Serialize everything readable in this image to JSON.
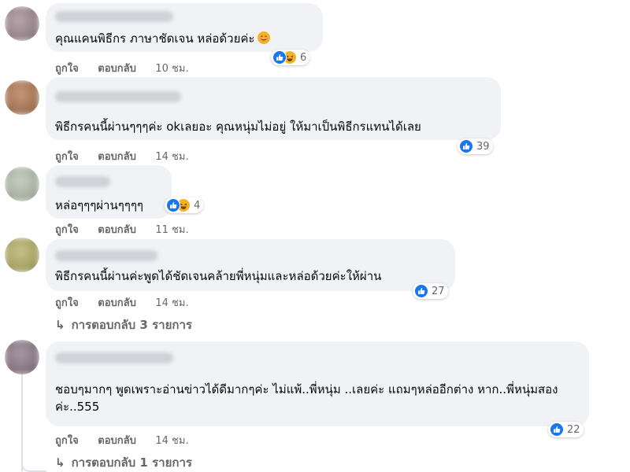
{
  "comments": [
    {
      "text": "คุณแคนพิธีกร ภาษาชัดเจน หล่อด้วยค่ะ",
      "emoji": "smiling-face",
      "reaction_count": "6",
      "like_label": "ถูกใจ",
      "reply_label": "ตอบกลับ",
      "time": "10 ชม."
    },
    {
      "text": "พิธีกรคนนี้ผ่านๆๆๆค่ะ okเลยอะ คุณหนุ่มไม่อยู่ ให้มาเป็นพิธีกรแทนได้เลย",
      "reaction_count": "39",
      "like_label": "ถูกใจ",
      "reply_label": "ตอบกลับ",
      "time": "14 ชม."
    },
    {
      "text": "หล่อๆๆๆผ่านๆๆๆๆ",
      "reaction_count": "4",
      "like_label": "ถูกใจ",
      "reply_label": "ตอบกลับ",
      "time": "11 ชม."
    },
    {
      "text": "พิธีกรคนนี้ผ่านค่ะพูดได้ชัดเจนคล้ายพี่หนุ่มและหล่อด้วยค่ะให้ผ่าน",
      "reaction_count": "27",
      "like_label": "ถูกใจ",
      "reply_label": "ตอบกลับ",
      "time": "14 ชม.",
      "replies_label": "การตอบกลับ 3 รายการ"
    },
    {
      "text": "ชอบๆมากๆ พูดเพราะอ่านข่าวได้ดีมากๆค่ะ ไม่แพ้..พี่หนุ่ม ..เลยค่ะ แถมๆหล่ออีกต่าง หาก..พี่หนุ่มสองค่ะ..555",
      "reaction_count": "22",
      "like_label": "ถูกใจ",
      "reply_label": "ตอบกลับ",
      "time": "14 ชม.",
      "replies_label": "การตอบกลับ 1 รายการ"
    }
  ],
  "colors": {
    "bubble": "#f0f2f5",
    "like": "#1877f2",
    "haha": "#f7b125",
    "meta": "#65676b"
  },
  "icons": [
    "like-icon",
    "haha-icon",
    "reply-arrow-icon"
  ]
}
